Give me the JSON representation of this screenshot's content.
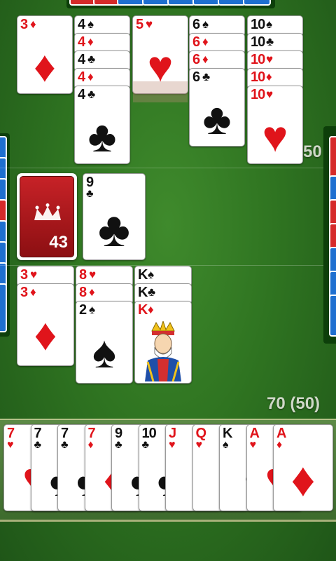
{
  "opponent_top": {
    "card_backs": 8
  },
  "opponent_area": {
    "score": "50",
    "melds": [
      {
        "cards": [
          {
            "rank": "3",
            "suit": "♦",
            "color": "red"
          }
        ]
      },
      {
        "cards": [
          {
            "rank": "4",
            "suit": "♠",
            "color": "black"
          },
          {
            "rank": "4",
            "suit": "♦",
            "color": "red"
          },
          {
            "rank": "4",
            "suit": "♣",
            "color": "black"
          },
          {
            "rank": "4",
            "suit": "♦",
            "color": "red"
          },
          {
            "rank": "4",
            "suit": "♣",
            "color": "black"
          }
        ]
      },
      {
        "cards": [
          {
            "rank": "5",
            "suit": "♥",
            "color": "red"
          }
        ]
      },
      {
        "cards": [
          {
            "rank": "6",
            "suit": "♠",
            "color": "black"
          },
          {
            "rank": "6",
            "suit": "♦",
            "color": "red"
          },
          {
            "rank": "6",
            "suit": "♦",
            "color": "red"
          },
          {
            "rank": "6",
            "suit": "♣",
            "color": "black"
          }
        ]
      },
      {
        "cards": [
          {
            "rank": "10",
            "suit": "♠",
            "color": "black"
          },
          {
            "rank": "10",
            "suit": "♣",
            "color": "black"
          },
          {
            "rank": "10",
            "suit": "♥",
            "color": "red"
          },
          {
            "rank": "10",
            "suit": "♦",
            "color": "red"
          },
          {
            "rank": "10",
            "suit": "♥",
            "color": "red"
          }
        ]
      }
    ]
  },
  "center": {
    "stock_count": "43",
    "discard": {
      "rank": "9",
      "suit": "♣",
      "color": "black"
    }
  },
  "player_area": {
    "score": "70 (50)",
    "melds": [
      {
        "cards": [
          {
            "rank": "3",
            "suit": "♥",
            "color": "red"
          },
          {
            "rank": "3",
            "suit": "♦",
            "color": "red"
          }
        ]
      },
      {
        "cards": [
          {
            "rank": "8",
            "suit": "♥",
            "color": "red"
          },
          {
            "rank": "8",
            "suit": "♦",
            "color": "red"
          },
          {
            "rank": "2",
            "suit": "♠",
            "color": "black"
          }
        ]
      },
      {
        "cards": [
          {
            "rank": "K",
            "suit": "♠",
            "color": "black"
          },
          {
            "rank": "K",
            "suit": "♣",
            "color": "black"
          },
          {
            "rank": "K",
            "suit": "♦",
            "color": "red",
            "face": true
          }
        ]
      }
    ]
  },
  "hand": [
    {
      "rank": "7",
      "suit": "♥",
      "color": "red"
    },
    {
      "rank": "7",
      "suit": "♣",
      "color": "black"
    },
    {
      "rank": "7",
      "suit": "♣",
      "color": "black"
    },
    {
      "rank": "7",
      "suit": "♦",
      "color": "red"
    },
    {
      "rank": "9",
      "suit": "♣",
      "color": "black"
    },
    {
      "rank": "10",
      "suit": "♣",
      "color": "black"
    },
    {
      "rank": "J",
      "suit": "♥",
      "color": "red"
    },
    {
      "rank": "Q",
      "suit": "♥",
      "color": "red"
    },
    {
      "rank": "K",
      "suit": "♠",
      "color": "black"
    },
    {
      "rank": "A",
      "suit": "♥",
      "color": "red"
    },
    {
      "rank": "A",
      "suit": "♦",
      "color": "red"
    }
  ],
  "colors": {
    "felt": "#2f7421",
    "card_red": "#e0141b",
    "back_blue": "#1e6fd0",
    "back_red": "#d52a2a"
  }
}
